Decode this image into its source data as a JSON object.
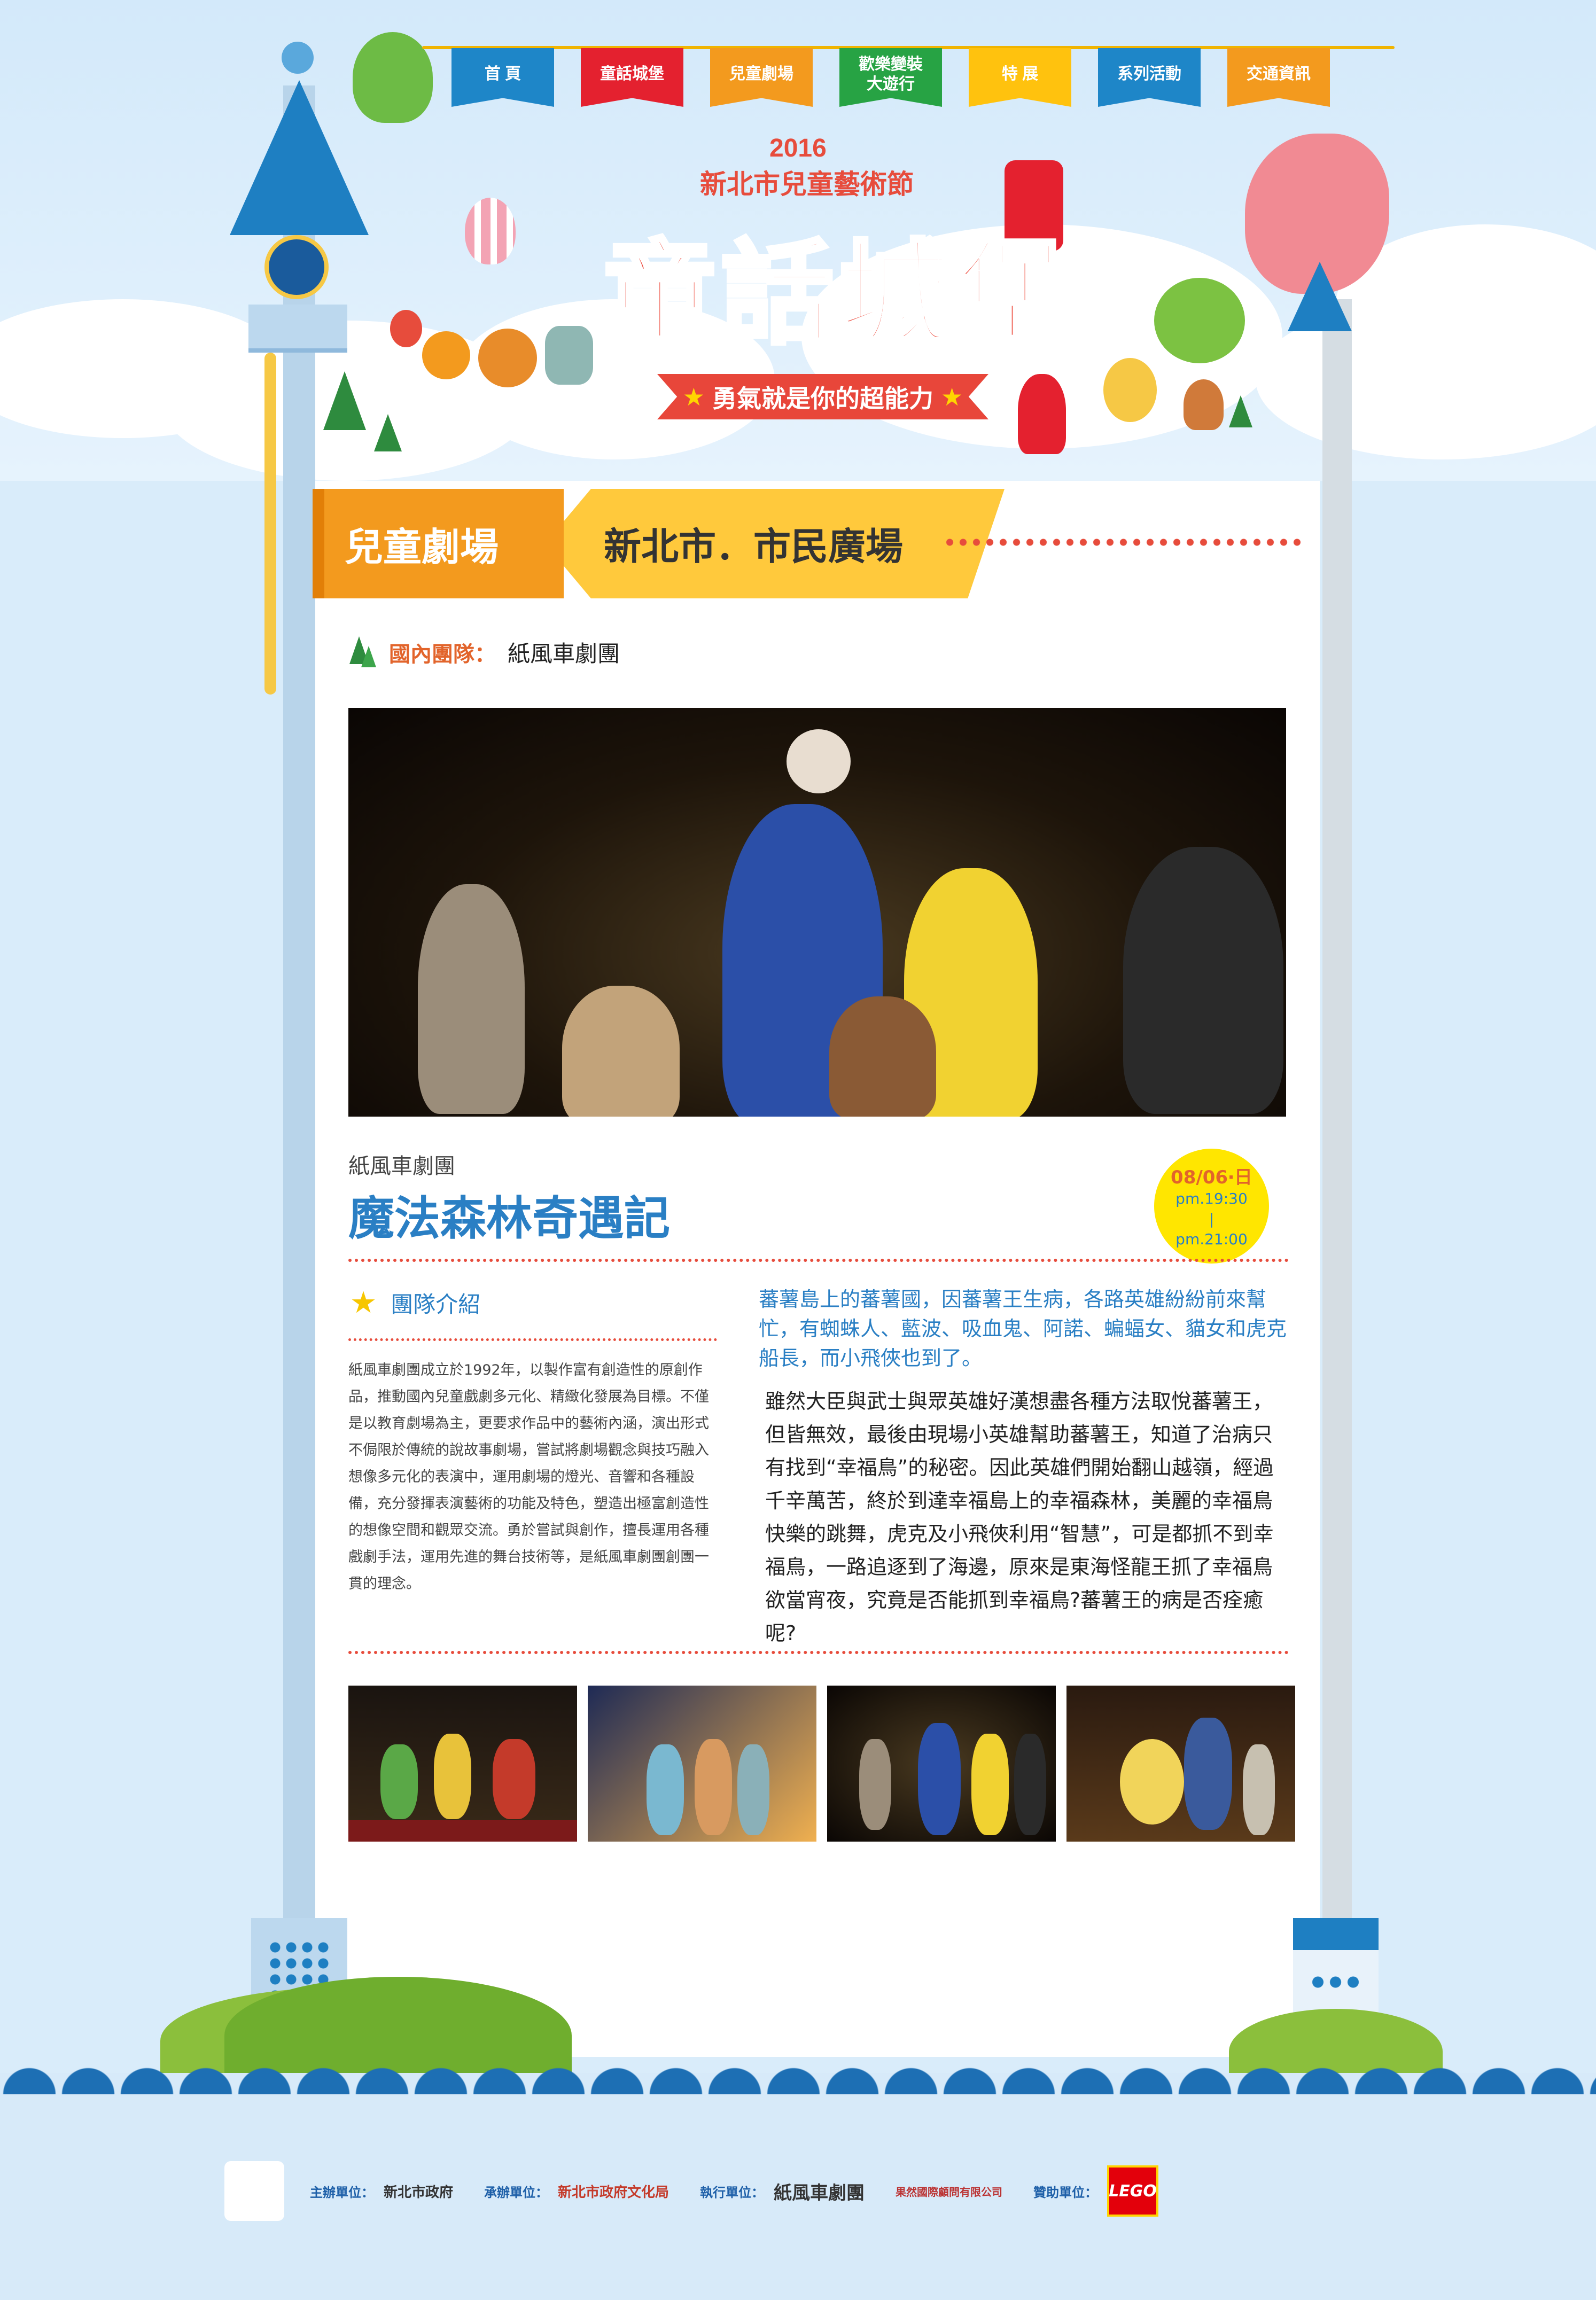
{
  "nav": {
    "items": [
      {
        "label": "首 頁",
        "color": "#1e86c8"
      },
      {
        "label": "童話城堡",
        "color": "#e4212f"
      },
      {
        "label": "兒童劇場",
        "color": "#f39a1e"
      },
      {
        "label": "歡樂變裝\n大遊行",
        "color": "#27a344"
      },
      {
        "label": "特 展",
        "color": "#ffc20e"
      },
      {
        "label": "系列活動",
        "color": "#1e86c8"
      },
      {
        "label": "交通資訊",
        "color": "#f39a1e"
      }
    ]
  },
  "logo": {
    "year": "2016",
    "subtitle": "新北市兒童藝術節",
    "main": "童話城堡",
    "slogan": "勇氣就是你的超能力"
  },
  "banner": {
    "section": "兒童劇場",
    "venue": "新北市．市民廣場"
  },
  "team": {
    "label": "國內團隊：",
    "name": "紙風車劇團"
  },
  "show": {
    "troupe": "紙風車劇團",
    "title": "魔法森林奇遇記",
    "date": "08/06‧日",
    "time_start": "pm.19:30",
    "time_sep": "|",
    "time_end": "pm.21:00"
  },
  "intro": {
    "heading": "團隊介紹",
    "text": "紙風車劇團成立於1992年，以製作富有創造性的原創作品，推動國內兒童戲劇多元化、精緻化發展為目標。不僅是以教育劇場為主，更要求作品中的藝術內涵，演出形式不侷限於傳統的說故事劇場，嘗試將劇場觀念與技巧融入想像多元化的表演中，運用劇場的燈光、音響和各種設備，充分發揮表演藝術的功能及特色，塑造出極富創造性的想像空間和觀眾交流。勇於嘗試與創作，擅長運用各種戲劇手法，運用先進的舞台技術等，是紙風車劇團創團一貫的理念。"
  },
  "story": {
    "lead": "蕃薯島上的蕃薯國，因蕃薯王生病，各路英雄紛紛前來幫忙，有蜘蛛人、藍波、吸血鬼、阿諾、蝙蝠女、貓女和虎克船長，而小飛俠也到了。",
    "body": "雖然大臣與武士與眾英雄好漢想盡各種方法取悅蕃薯王，但皆無效，最後由現場小英雄幫助蕃薯王，知道了治病只有找到“幸福鳥”的秘密。因此英雄們開始翻山越嶺，經過千辛萬苦，終於到達幸福島上的幸福森林，美麗的幸福鳥快樂的跳舞，虎克及小飛俠利用“智慧”，可是都抓不到幸福鳥，一路追逐到了海邊，原來是東海怪龍王抓了幸福鳥欲當宵夜，究竟是否能抓到幸福鳥?蕃薯王的病是否痊癒呢?"
  },
  "footer": {
    "host_label": "主辦單位：",
    "host": "新北市政府",
    "co_label": "承辦單位：",
    "co": "新北市政府文化局",
    "exec_label": "執行單位：",
    "exec": "紙風車劇團",
    "exec2": "果然國際顧問有限公司",
    "sponsor_label": "贊助單位：",
    "sponsor": "LEGO"
  }
}
